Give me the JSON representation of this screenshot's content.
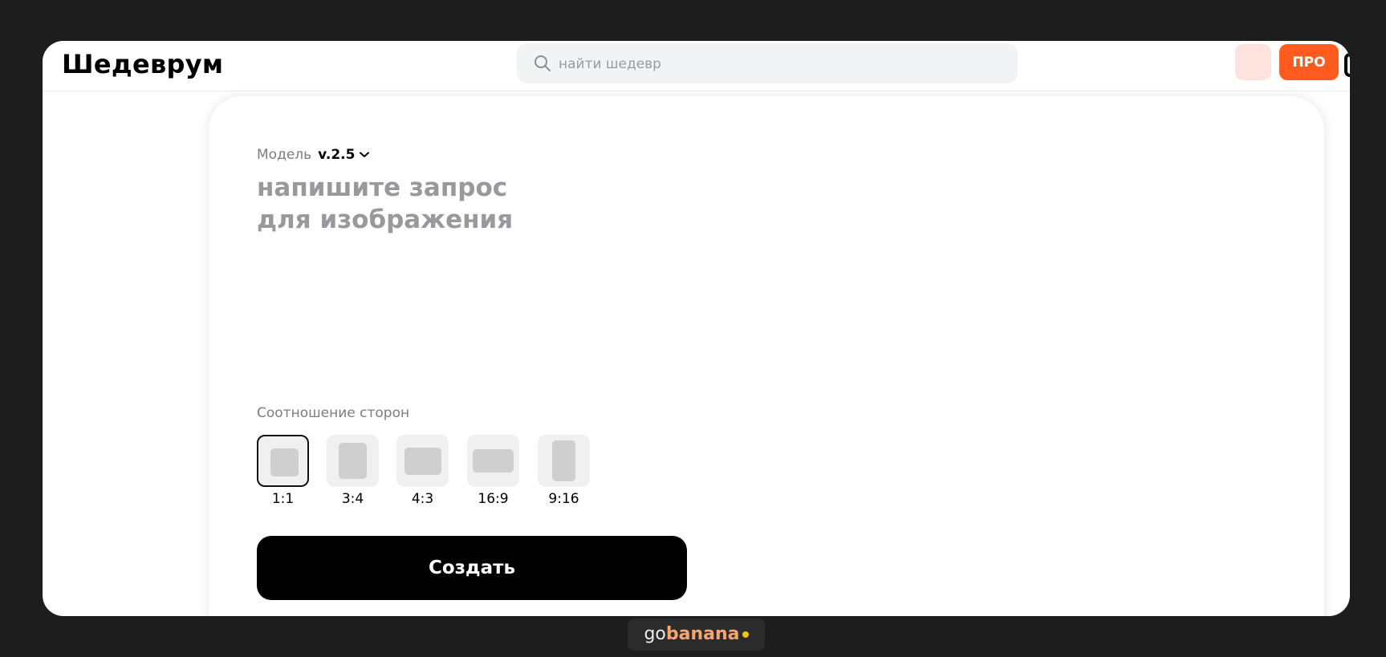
{
  "header": {
    "logo": "Шедеврум",
    "search_placeholder": "найти шедевр",
    "pro_label": "ПРО"
  },
  "editor": {
    "model_label": "Модель",
    "model_value": "v.2.5",
    "prompt_placeholder": "напишите запрос\nдля изображения",
    "ratio_label": "Соотношение сторон",
    "ratios": [
      {
        "label": "1:1",
        "selected": true
      },
      {
        "label": "3:4",
        "selected": false
      },
      {
        "label": "4:3",
        "selected": false
      },
      {
        "label": "16:9",
        "selected": false
      },
      {
        "label": "9:16",
        "selected": false
      }
    ],
    "create_label": "Создать"
  },
  "watermark": {
    "part1": "go",
    "part2": "banana"
  },
  "colors": {
    "accent": "#ff5a1f",
    "avatar": "#fde2de",
    "page_background": "#1d1d1d"
  },
  "icons": [
    "search-icon",
    "chevron-down-icon",
    "ratio-shape-icon"
  ]
}
